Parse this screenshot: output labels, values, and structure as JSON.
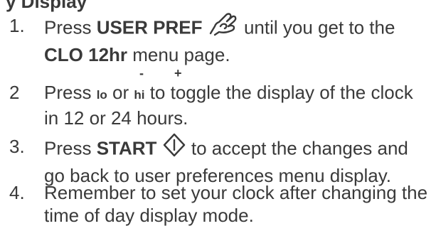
{
  "heading_partial": "y Display",
  "steps": [
    {
      "number": "1.",
      "line1_before": "Press ",
      "line1_bold": "USER PREF",
      "line1_after": " until you get to the",
      "line2_bold": "CLO 12hr",
      "line2_after": " menu page."
    },
    {
      "number": "2",
      "minus_sign": "-",
      "plus_sign": "+",
      "before": "Press ",
      "key_lo": "lo",
      "middle": " or ",
      "key_hi": "hi",
      "after_line1": " to toggle the display of the clock",
      "line2": "in 12 or 24 hours."
    },
    {
      "number": "3.",
      "line1_before": "Press ",
      "line1_bold": "START",
      "line1_after": " to accept the changes and",
      "line2": "go back to user preferences menu display."
    },
    {
      "number": "4.",
      "line1": "Remember to set your clock after changing the",
      "line2": "time of day display mode."
    }
  ],
  "icons": {
    "user_pref": "hand-pref-icon",
    "start": "start-diamond-icon"
  },
  "colors": {
    "text": "#3a3a3a"
  }
}
